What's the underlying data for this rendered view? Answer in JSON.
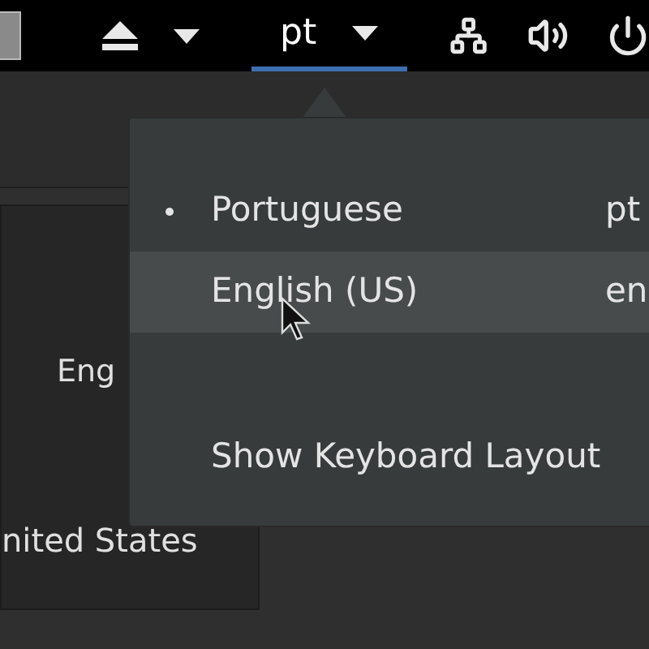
{
  "top_bar": {
    "keyboard_indicator": "pt",
    "keyboard_indicator_active": true
  },
  "background_panel": {
    "texts": [
      "Eng",
      "nited States"
    ]
  },
  "keyboard_menu": {
    "items": [
      {
        "kind": "layout",
        "label": "Portuguese",
        "code": "pt",
        "selected": true,
        "highlighted": false
      },
      {
        "kind": "layout",
        "label": "English (US)",
        "code": "en",
        "selected": false,
        "highlighted": true
      },
      {
        "kind": "action",
        "label": "Show Keyboard Layout"
      }
    ]
  }
}
